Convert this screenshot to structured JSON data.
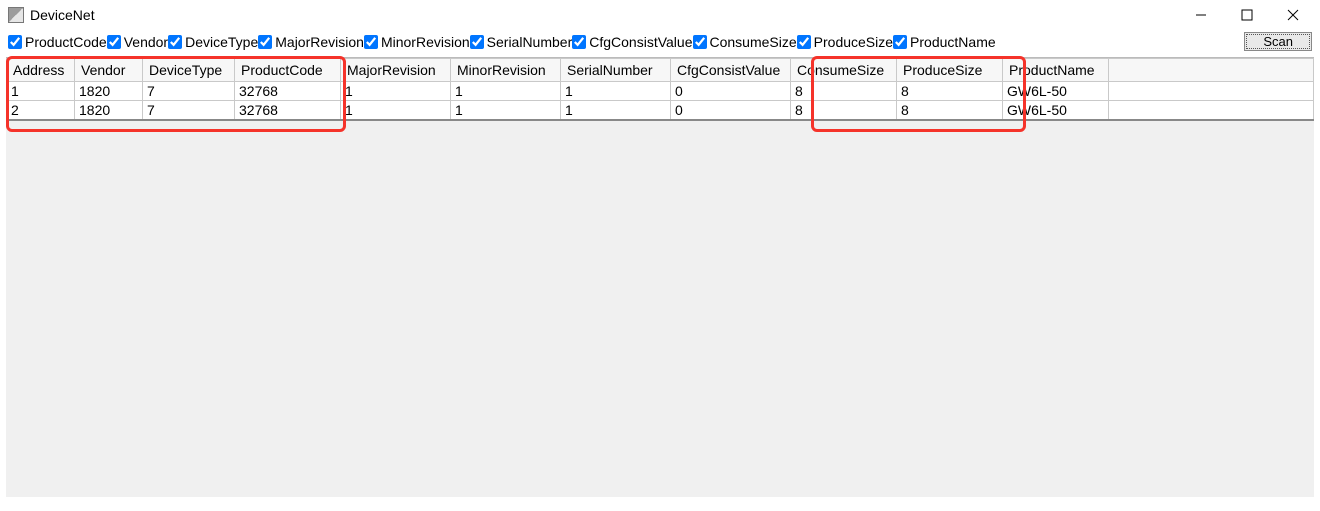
{
  "window": {
    "title": "DeviceNet"
  },
  "checkboxes": [
    {
      "label": "ProductCode",
      "checked": true
    },
    {
      "label": "Vendor",
      "checked": true
    },
    {
      "label": "DeviceType",
      "checked": true
    },
    {
      "label": "MajorRevision",
      "checked": true
    },
    {
      "label": "MinorRevision",
      "checked": true
    },
    {
      "label": "SerialNumber",
      "checked": true
    },
    {
      "label": "CfgConsistValue",
      "checked": true
    },
    {
      "label": "ConsumeSize",
      "checked": true
    },
    {
      "label": "ProduceSize",
      "checked": true
    },
    {
      "label": "ProductName",
      "checked": true
    }
  ],
  "buttons": {
    "scan": "Scan"
  },
  "table": {
    "headers": [
      "Address",
      "Vendor",
      "DeviceType",
      "ProductCode",
      "MajorRevision",
      "MinorRevision",
      "SerialNumber",
      "CfgConsistValue",
      "ConsumeSize",
      "ProduceSize",
      "ProductName"
    ],
    "rows": [
      {
        "Address": "1",
        "Vendor": "1820",
        "DeviceType": "7",
        "ProductCode": "32768",
        "MajorRevision": "1",
        "MinorRevision": "1",
        "SerialNumber": "1",
        "CfgConsistValue": "0",
        "ConsumeSize": "8",
        "ProduceSize": "8",
        "ProductName": "GW6L-50"
      },
      {
        "Address": "2",
        "Vendor": "1820",
        "DeviceType": "7",
        "ProductCode": "32768",
        "MajorRevision": "1",
        "MinorRevision": "1",
        "SerialNumber": "1",
        "CfgConsistValue": "0",
        "ConsumeSize": "8",
        "ProduceSize": "8",
        "ProductName": "GW6L-50"
      }
    ]
  }
}
